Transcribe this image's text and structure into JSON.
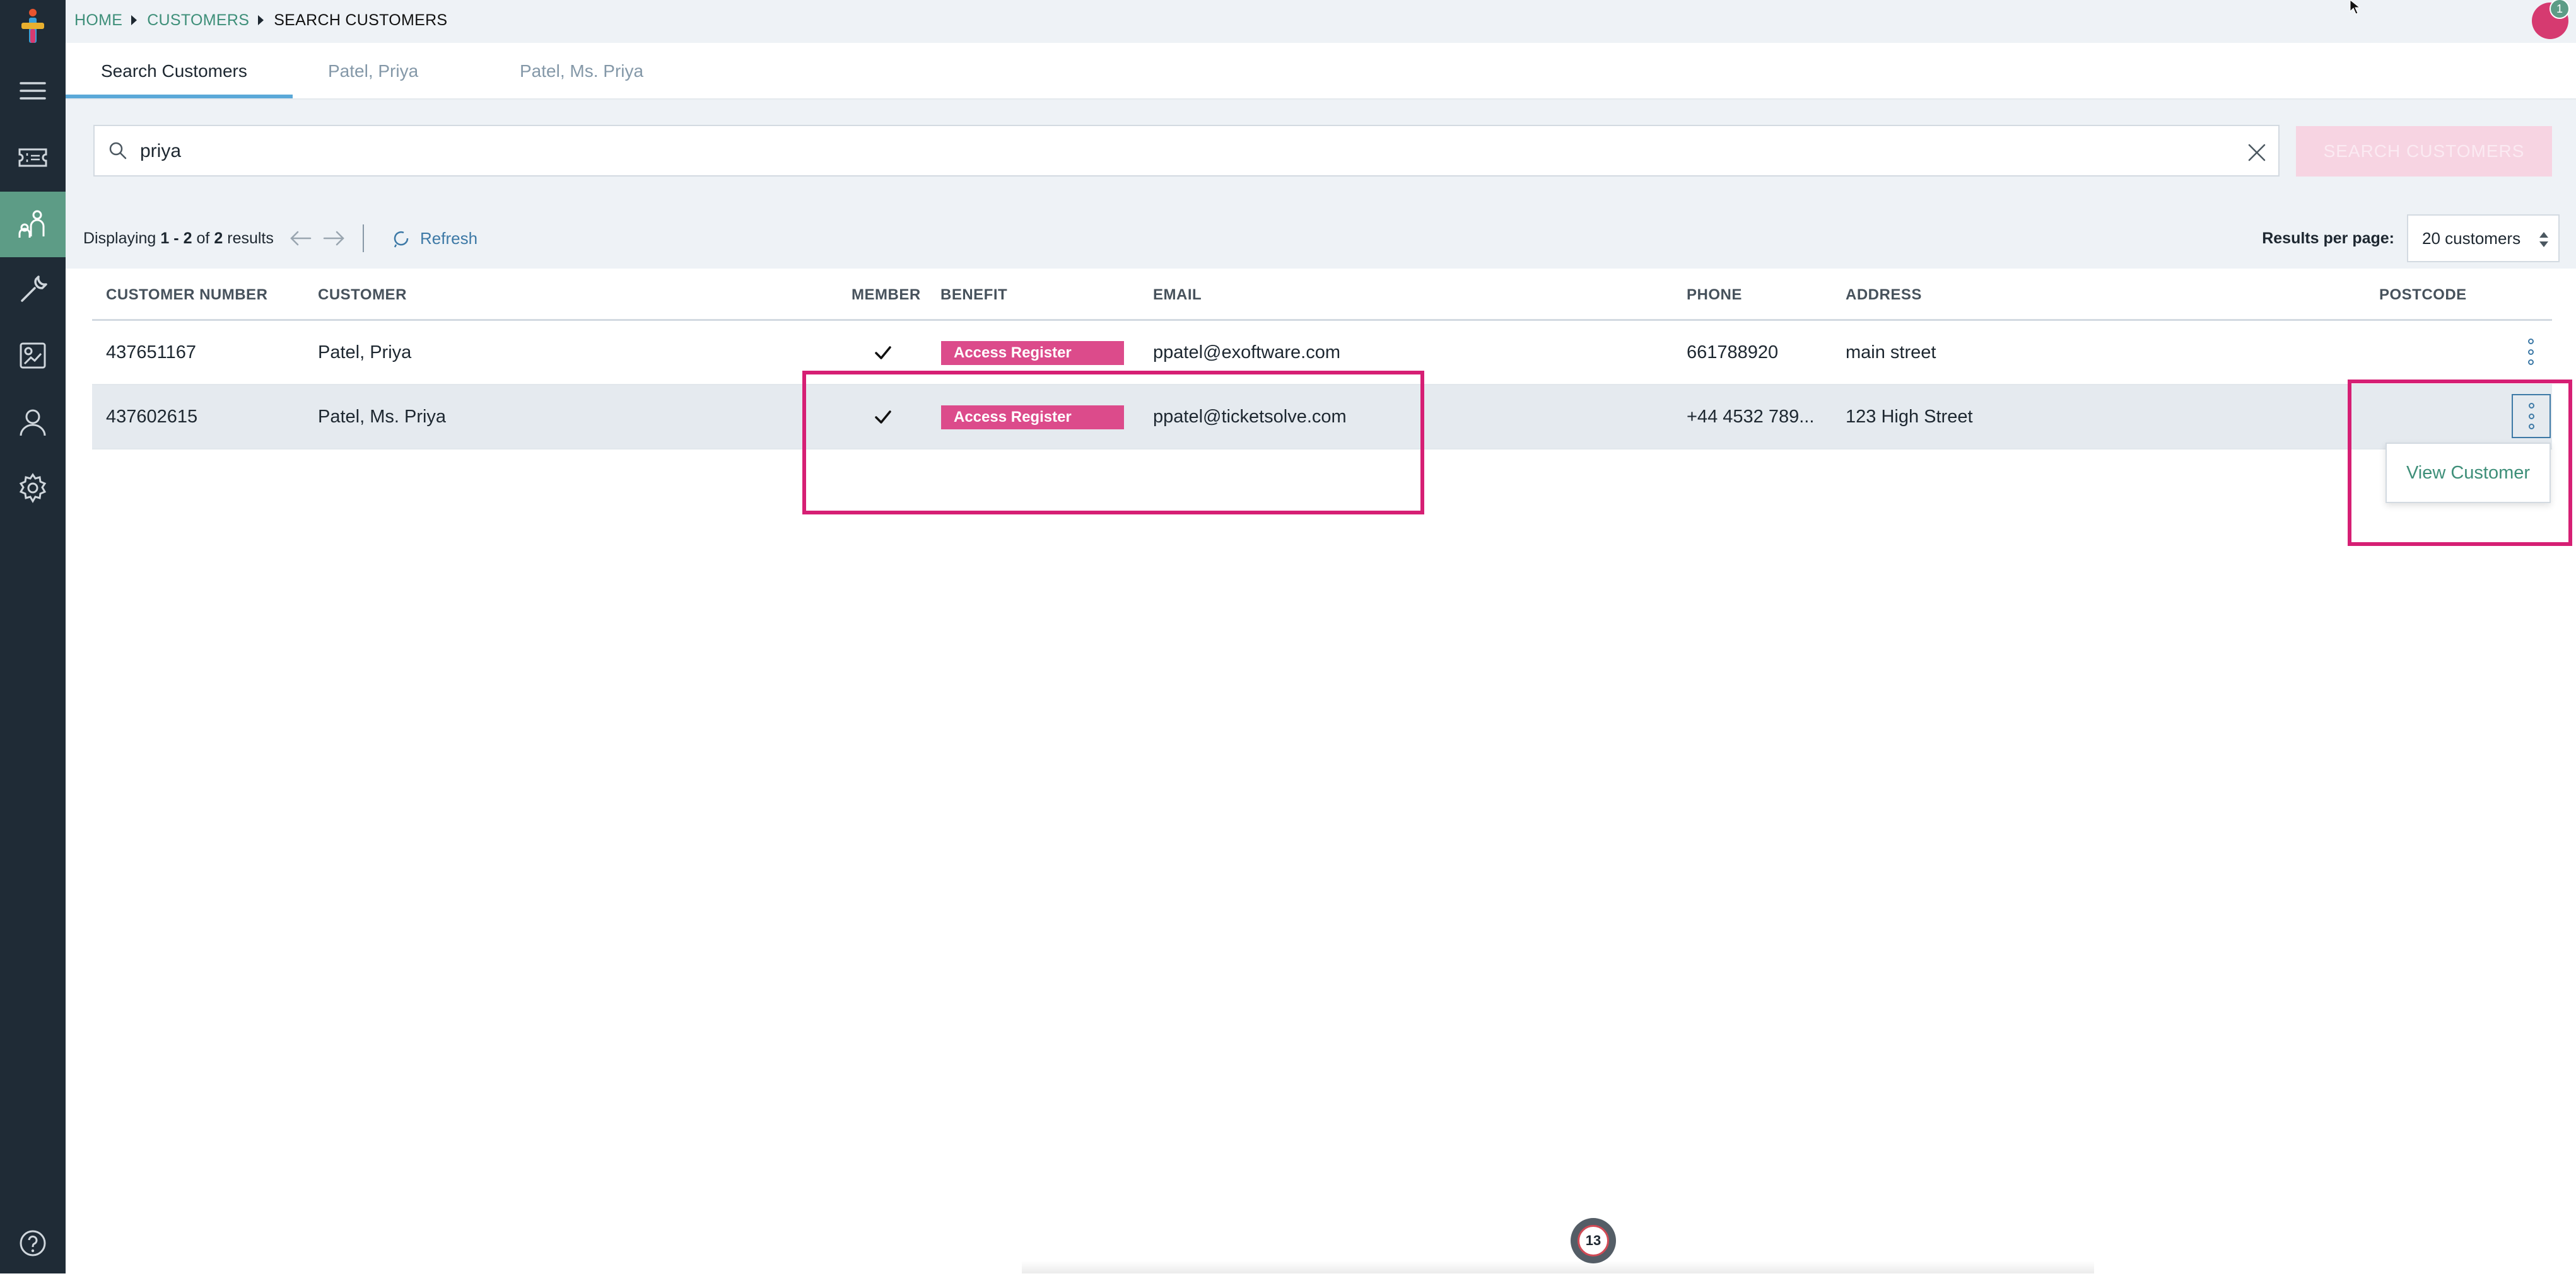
{
  "breadcrumb": {
    "home": "HOME",
    "customers": "CUSTOMERS",
    "current": "SEARCH CUSTOMERS"
  },
  "notifications": {
    "count": "1"
  },
  "tabs": [
    {
      "label": "Search Customers",
      "active": true
    },
    {
      "label": "Patel, Priya",
      "active": false
    },
    {
      "label": "Patel, Ms. Priya",
      "active": false
    }
  ],
  "search": {
    "value": "priya",
    "button_label": "SEARCH CUSTOMERS"
  },
  "results": {
    "prefix": "Displaying",
    "from": "1",
    "dash": "-",
    "to": "2",
    "of": "of",
    "total": "2",
    "suffix": "results",
    "refresh_label": "Refresh",
    "per_page_label": "Results per page:",
    "per_page_value": "20 customers"
  },
  "table": {
    "columns": [
      "CUSTOMER NUMBER",
      "CUSTOMER",
      "MEMBER",
      "BENEFIT",
      "EMAIL",
      "PHONE",
      "ADDRESS",
      "POSTCODE"
    ],
    "rows": [
      {
        "customer_number": "437651167",
        "customer": "Patel, Priya",
        "member": true,
        "benefit": "Access Register",
        "email": "ppatel@exoftware.com",
        "phone": "661788920",
        "address": "main street",
        "postcode": ""
      },
      {
        "customer_number": "437602615",
        "customer": "Patel, Ms. Priya",
        "member": true,
        "benefit": "Access Register",
        "email": "ppatel@ticketsolve.com",
        "phone": "+44 4532 789...",
        "address": "123 High Street",
        "postcode": ""
      }
    ]
  },
  "row_menu": {
    "view_customer": "View Customer"
  },
  "bottom_widget": {
    "count": "13"
  },
  "colors": {
    "sidebar": "#1f2b36",
    "accent_green": "#5d9c86",
    "link_green": "#3e8f79",
    "brand_pink": "#dc4b8b",
    "highlight_frame": "#d61f74",
    "link_blue": "#3d79a6"
  },
  "icons": {
    "sidebar": [
      "menu-icon",
      "ticket-icon",
      "customers-icon",
      "tools-icon",
      "reports-icon",
      "user-icon",
      "settings-icon",
      "help-icon"
    ]
  }
}
